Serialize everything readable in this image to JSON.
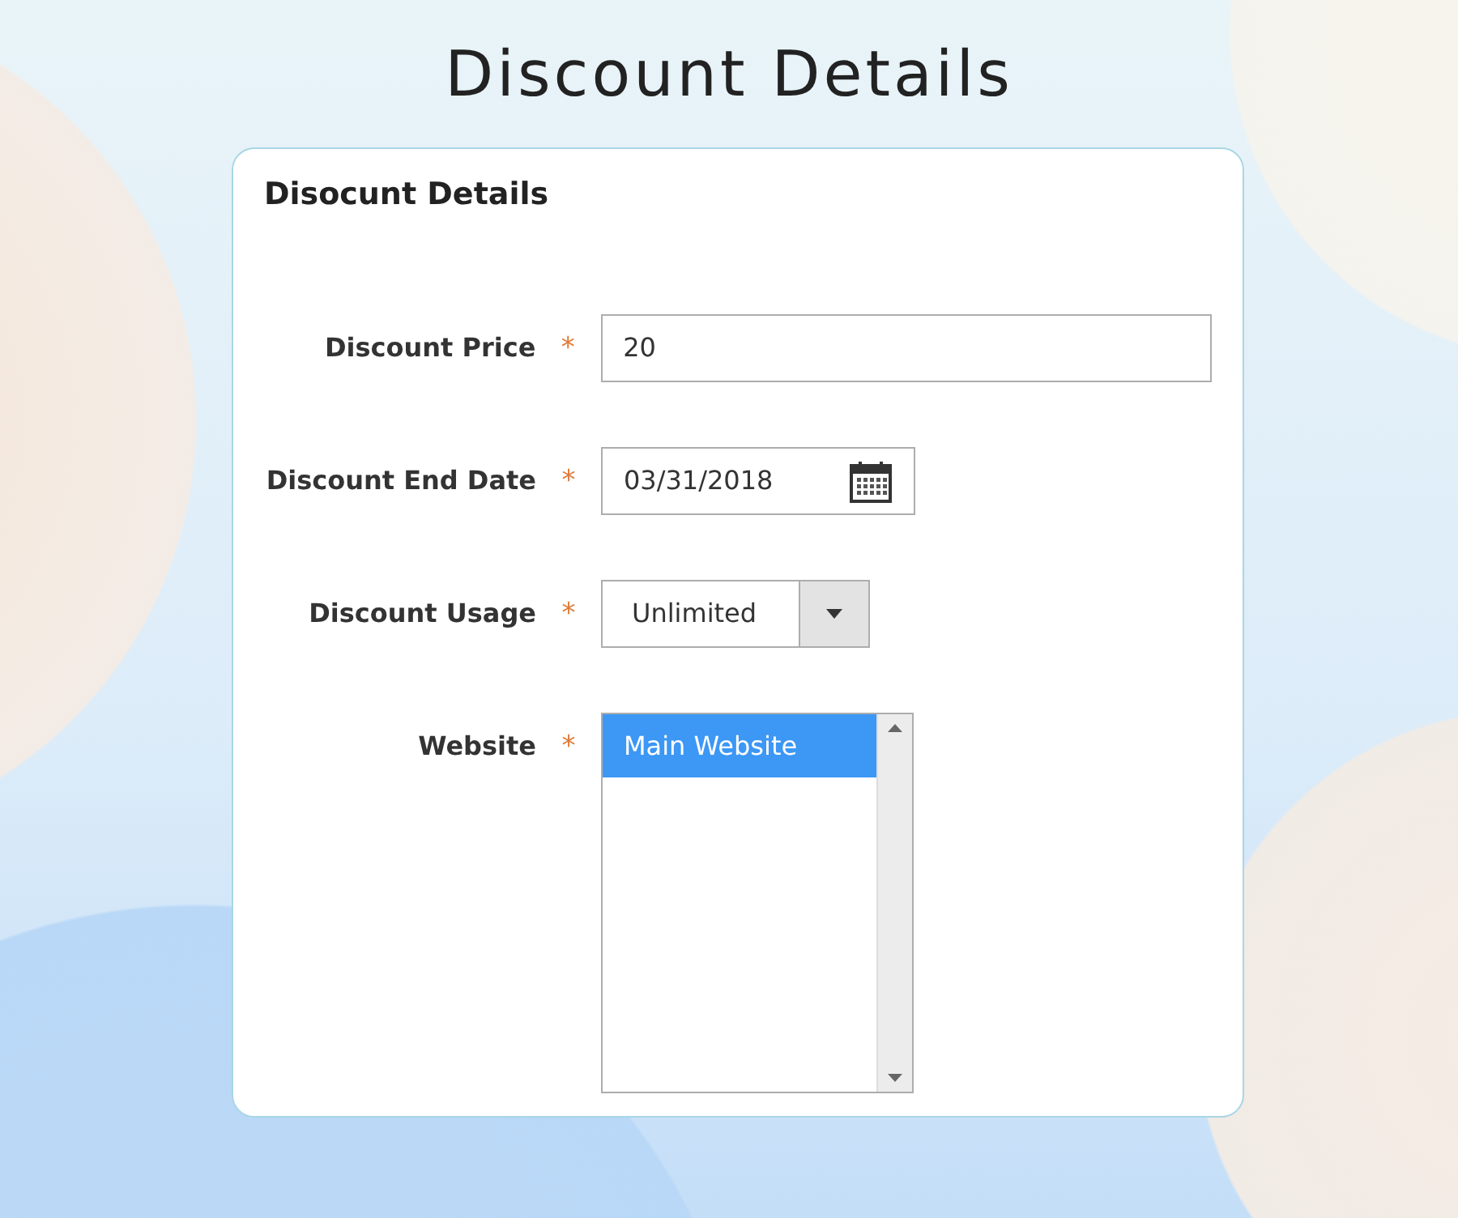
{
  "heading": "Discount Details",
  "panel": {
    "title": "Disocunt Details",
    "fields": [
      {
        "kind": "text",
        "label": "Discount Price",
        "required_mark": "*",
        "value": "20"
      },
      {
        "kind": "date",
        "label": "Discount End Date",
        "required_mark": "*",
        "value": "03/31/2018"
      },
      {
        "kind": "select",
        "label": "Discount Usage",
        "required_mark": "*",
        "value": "Unlimited"
      },
      {
        "kind": "multiselect",
        "label": "Website",
        "required_mark": "*",
        "options": [
          {
            "label": "Main Website",
            "selected": true
          }
        ]
      }
    ]
  }
}
